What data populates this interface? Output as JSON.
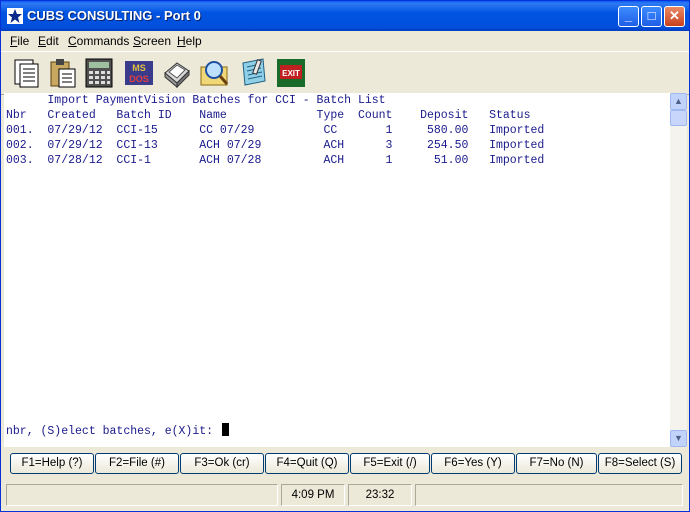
{
  "window": {
    "title": "CUBS CONSULTING - Port 0",
    "minimize": "_",
    "maximize": "□",
    "close": "✕"
  },
  "menu": [
    {
      "first": "F",
      "rest": "ile"
    },
    {
      "first": "E",
      "rest": "dit"
    },
    {
      "first": "C",
      "rest": "ommands"
    },
    {
      "first": "S",
      "rest": "creen"
    },
    {
      "first": "H",
      "rest": "elp"
    }
  ],
  "toolbar": {
    "icons": [
      "document-icon",
      "clipboard-icon",
      "calculator-icon",
      "ms-dos-icon",
      "printer-icon",
      "search-icon",
      "notepad-icon",
      "exit-icon"
    ],
    "msdos_label": "MS DOS",
    "exit_label": "EXIT"
  },
  "terminal": {
    "title": "      Import PaymentVision Batches for CCI - Batch List",
    "header": "Nbr   Created   Batch ID    Name             Type  Count    Deposit   Status",
    "rows": [
      "001.  07/29/12  CCI-15      CC 07/29          CC       1     580.00   Imported",
      "002.  07/29/12  CCI-13      ACH 07/29         ACH      3     254.50   Imported",
      "003.  07/28/12  CCI-1       ACH 07/28         ACH      1      51.00   Imported"
    ],
    "prompt": "nbr, (S)elect batches, e(X)it: "
  },
  "scrollbar": {
    "up": "▲",
    "down": "▼"
  },
  "fkeys": [
    "F1=Help (?)",
    "F2=File (#)",
    "F3=Ok (cr)",
    "F4=Quit (Q)",
    "F5=Exit (/)",
    "F6=Yes (Y)",
    "F7=No (N)",
    "F8=Select (S)"
  ],
  "status": {
    "left": "",
    "time": "4:09 PM",
    "elapsed": "23:32",
    "right": ""
  },
  "colors": {
    "terminal_text": "#1a1a8c",
    "titlebar": "#0053e1"
  }
}
